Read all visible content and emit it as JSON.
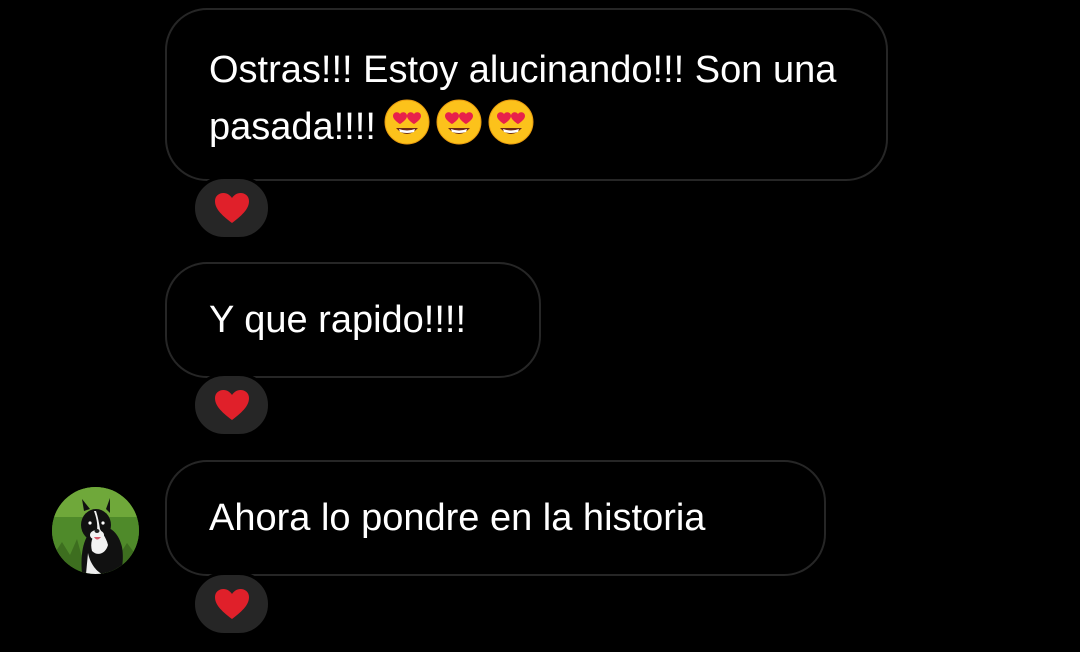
{
  "messages": [
    {
      "text": "Ostras!!! Estoy alucinando!!! Son una pasada!!!!",
      "emojis": [
        "heart-eyes",
        "heart-eyes",
        "heart-eyes"
      ],
      "reaction": "heart"
    },
    {
      "text": "Y que rapido!!!!",
      "reaction": "heart"
    },
    {
      "text": "Ahora lo pondre en la historia",
      "reaction": "heart",
      "sender_avatar": "dog-avatar"
    }
  ],
  "colors": {
    "background": "#000000",
    "bubble_border": "#262626",
    "reaction_bg": "#262626",
    "heart": "#e0202a",
    "text": "#ffffff"
  }
}
